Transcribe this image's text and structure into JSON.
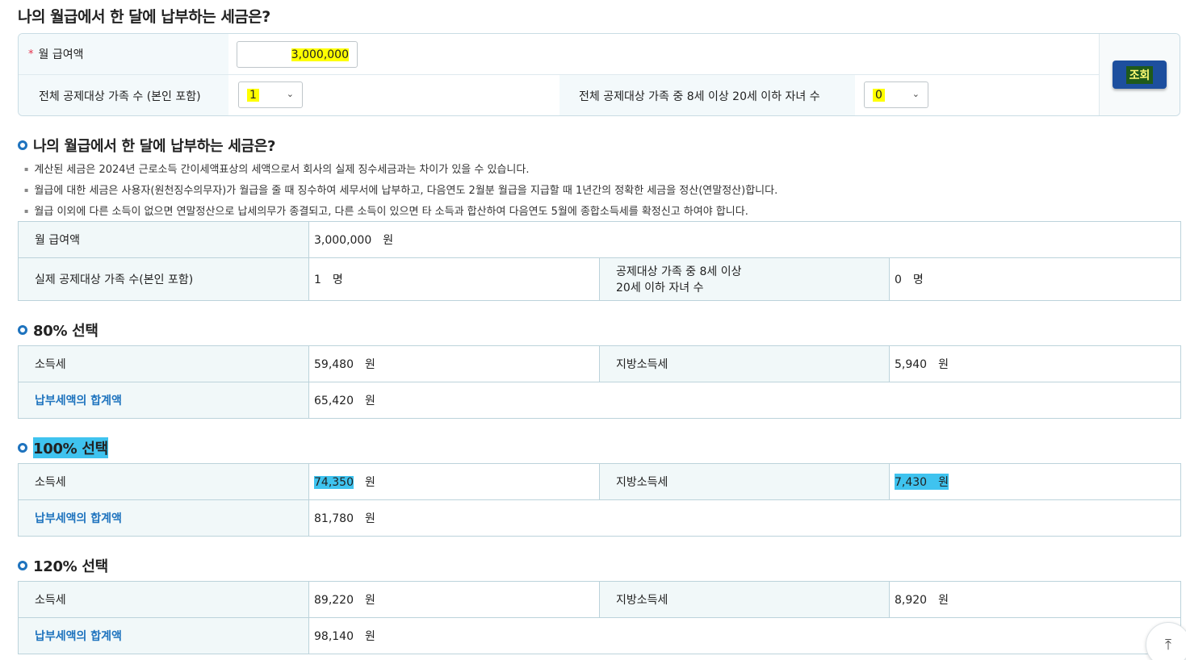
{
  "page_title": "나의 월급에서 한 달에 납부하는 세금은?",
  "form": {
    "salary_label": "월 급여액",
    "salary_required_mark": "*",
    "salary_value": "3,000,000",
    "family_label": "전체 공제대상 가족 수 (본인 포함)",
    "family_value": "1",
    "children_label": "전체 공제대상 가족 중 8세 이상 20세 이하 자녀 수",
    "children_value": "0",
    "search_button": "조회"
  },
  "result": {
    "title": "나의 월급에서 한 달에 납부하는 세금은?",
    "notes": [
      "계산된 세금은  2024년  근로소득 간이세액표상의 세액으로서 회사의 실제 징수세금과는 차이가 있을 수 있습니다.",
      "월급에 대한 세금은 사용자(원천징수의무자)가 월급을 줄 때 징수하여 세무서에 납부하고, 다음연도 2월분 월급을 지급할 때 1년간의 정확한 세금을 정산(연말정산)합니다.",
      "월급 이외에 다른 소득이 없으면 연말정산으로 납세의무가 종결되고, 다른 소득이 있으면 타 소득과 합산하여 다음연도 5월에 종합소득세를 확정신고 하여야 합니다."
    ],
    "salary_label": "월 급여액",
    "salary_value": "3,000,000",
    "salary_unit": "원",
    "family_label": "실제 공제대상 가족 수(본인 포함)",
    "family_value": "1",
    "family_unit": "명",
    "children_label_line1": "공제대상 가족 중 8세 이상",
    "children_label_line2": "20세 이하 자녀 수",
    "children_value": "0",
    "children_unit": "명"
  },
  "options": [
    {
      "title": "80% 선택",
      "income_tax_label": "소득세",
      "income_tax": "59,480",
      "local_tax_label": "지방소득세",
      "local_tax": "5,940",
      "total_label": "납부세액의 합계액",
      "total": "65,420",
      "unit": "원"
    },
    {
      "title": "100% 선택",
      "income_tax_label": "소득세",
      "income_tax": "74,350",
      "local_tax_label": "지방소득세",
      "local_tax": "7,430",
      "total_label": "납부세액의 합계액",
      "total": "81,780",
      "unit": "원"
    },
    {
      "title": "120% 선택",
      "income_tax_label": "소득세",
      "income_tax": "89,220",
      "local_tax_label": "지방소득세",
      "local_tax": "8,920",
      "total_label": "납부세액의 합계액",
      "total": "98,140",
      "unit": "원"
    }
  ],
  "colors": {
    "accent_blue": "#1e73be",
    "button_blue": "#1d4f9e",
    "highlight_yellow": "#ffff00",
    "highlight_cyan": "#3fc3ef",
    "label_bg": "#f1f8f9"
  },
  "icons": {
    "dropdown": "chevron-down-icon",
    "scroll_top": "arrow-up-icon",
    "section_bullet": "circle-bullet-icon"
  }
}
